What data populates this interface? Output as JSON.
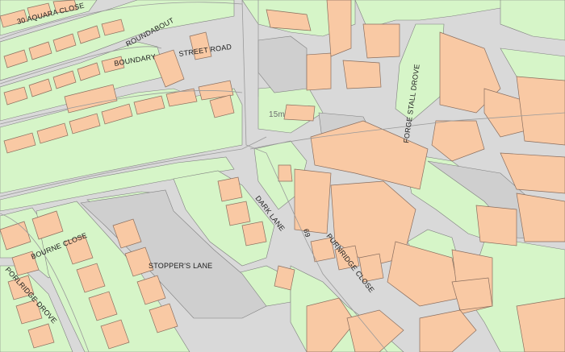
{
  "map": {
    "colors": {
      "road": "#d9d9d9",
      "land": "#d6f5c8",
      "building": "#f9c9a4",
      "building_stroke": "#8a6e5e",
      "paved": "#cfcfcf",
      "outline": "#6b6b6b"
    },
    "labels": {
      "aquara_close": "30 AQUARA CLOSE",
      "boundary": "BOUNDARY",
      "roundabout": "ROUNDABOUT",
      "street_road": "STREET ROAD",
      "spot_height": "15m",
      "forge_stall_drove": "FORGE STALL DROVE",
      "dark_lane": "DARK LANE",
      "stoppers_lane": "STOPPER'S LANE",
      "number_69": "69",
      "bourne_close": "BOURNE CLOSE",
      "purnridge_close": "PURNRIDGE CLOSE",
      "porlridge_drove": "PORLRIDGE DROVE"
    }
  }
}
